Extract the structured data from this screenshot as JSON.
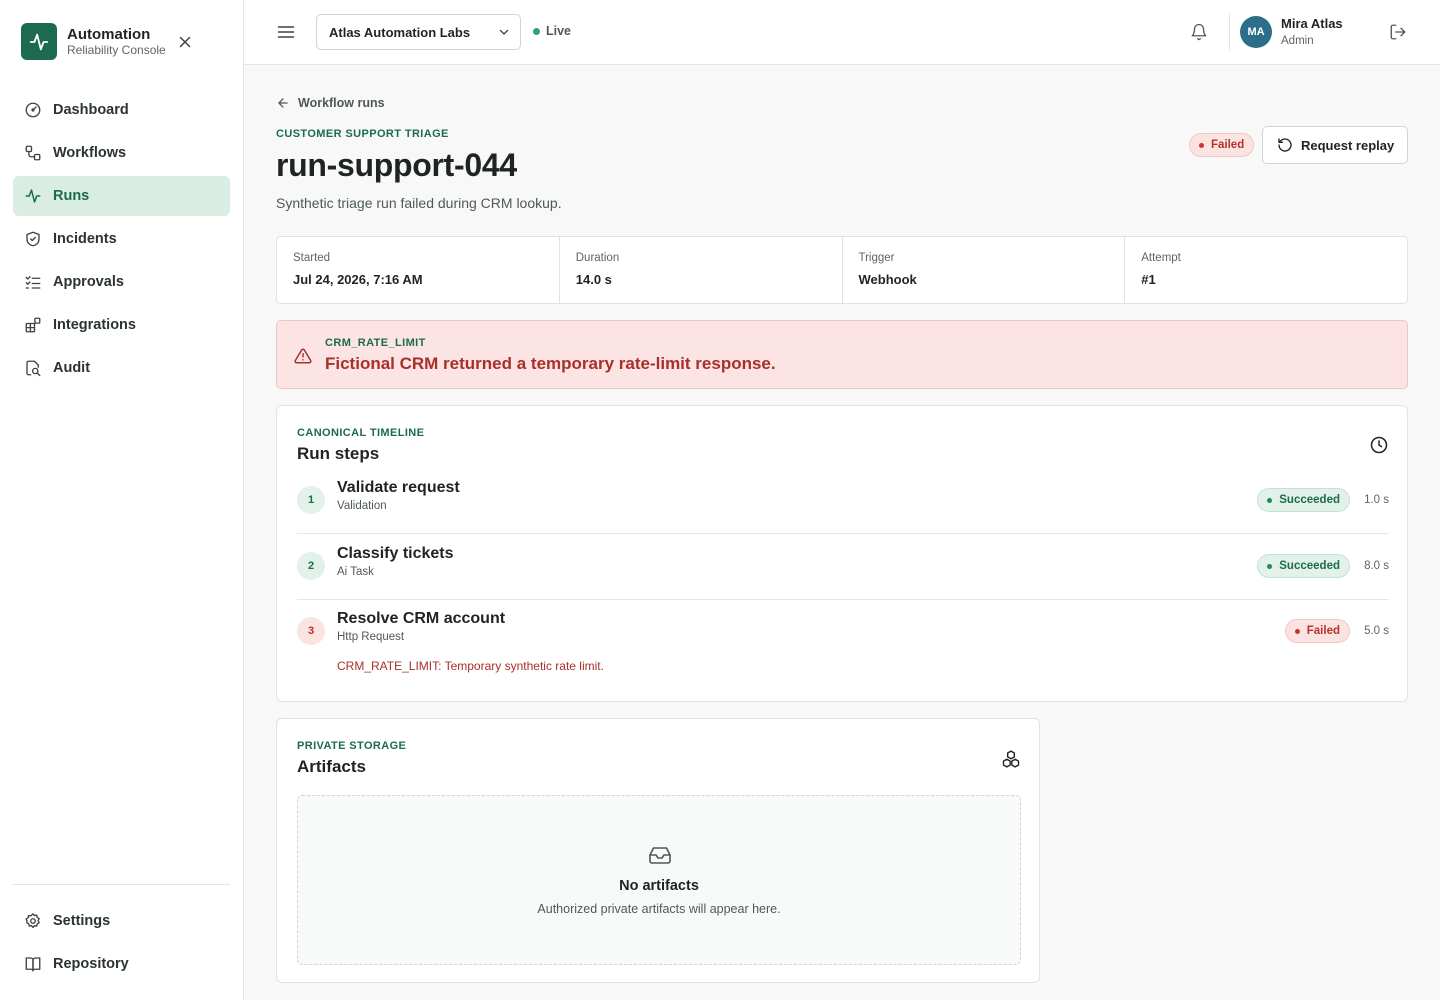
{
  "brand": {
    "title": "Automation",
    "subtitle": "Reliability Console"
  },
  "sidebar": {
    "items": [
      {
        "label": "Dashboard",
        "icon": "gauge-icon"
      },
      {
        "label": "Workflows",
        "icon": "workflow-icon"
      },
      {
        "label": "Runs",
        "icon": "activity-icon",
        "active": true
      },
      {
        "label": "Incidents",
        "icon": "shield-icon"
      },
      {
        "label": "Approvals",
        "icon": "checklist-icon"
      },
      {
        "label": "Integrations",
        "icon": "blocks-icon"
      },
      {
        "label": "Audit",
        "icon": "file-search-icon"
      }
    ],
    "bottom_items": [
      {
        "label": "Settings",
        "icon": "gear-icon"
      },
      {
        "label": "Repository",
        "icon": "book-icon"
      }
    ]
  },
  "topbar": {
    "workspace": "Atlas Automation Labs",
    "live_label": "Live",
    "user": {
      "initials": "MA",
      "name": "Mira Atlas",
      "role": "Admin"
    }
  },
  "run": {
    "back_label": "Workflow runs",
    "workflow": "CUSTOMER SUPPORT TRIAGE",
    "id": "run-support-044",
    "description": "Synthetic triage run failed during CRM lookup.",
    "status": "Failed",
    "replay_label": "Request replay",
    "meta": [
      {
        "label": "Started",
        "value": "Jul 24, 2026, 7:16 AM"
      },
      {
        "label": "Duration",
        "value": "14.0 s"
      },
      {
        "label": "Trigger",
        "value": "Webhook"
      },
      {
        "label": "Attempt",
        "value": "#1"
      }
    ],
    "error": {
      "code": "CRM_RATE_LIMIT",
      "message": "Fictional CRM returned a temporary rate-limit response."
    }
  },
  "timeline": {
    "eyebrow": "CANONICAL TIMELINE",
    "title": "Run steps",
    "steps": [
      {
        "num": "1",
        "name": "Validate request",
        "type": "Validation",
        "status": "Succeeded",
        "duration": "1.0 s"
      },
      {
        "num": "2",
        "name": "Classify tickets",
        "type": "Ai Task",
        "status": "Succeeded",
        "duration": "8.0 s"
      },
      {
        "num": "3",
        "name": "Resolve CRM account",
        "type": "Http Request",
        "status": "Failed",
        "duration": "5.0 s",
        "error": "CRM_RATE_LIMIT: Temporary synthetic rate limit."
      }
    ]
  },
  "artifacts": {
    "eyebrow": "PRIVATE STORAGE",
    "title": "Artifacts",
    "empty_title": "No artifacts",
    "empty_text": "Authorized private artifacts will appear here."
  },
  "colors": {
    "brand": "#1c6b4e",
    "danger": "#b3322c",
    "active_nav_bg": "#d9ede3"
  }
}
